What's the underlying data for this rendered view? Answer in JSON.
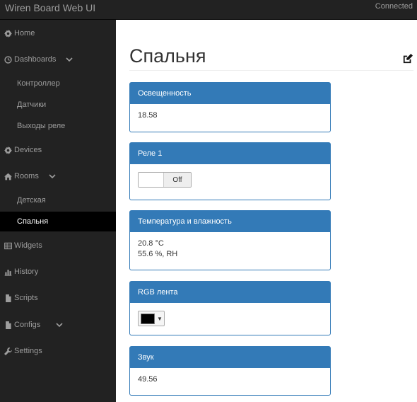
{
  "topbar": {
    "brand": "Wiren Board Web UI",
    "status": "Connected"
  },
  "sidebar": {
    "items": [
      {
        "key": "home",
        "label": "Home",
        "icon": "gear-icon"
      },
      {
        "key": "dashboards",
        "label": "Dashboards",
        "icon": "dashboard-icon"
      },
      {
        "key": "controller",
        "label": "Контроллер"
      },
      {
        "key": "sensors",
        "label": "Датчики"
      },
      {
        "key": "relay-outputs",
        "label": "Выходы реле"
      },
      {
        "key": "devices",
        "label": "Devices",
        "icon": "gear-icon"
      },
      {
        "key": "rooms",
        "label": "Rooms",
        "icon": "home-icon"
      },
      {
        "key": "kids-room",
        "label": "Детская"
      },
      {
        "key": "bedroom",
        "label": "Спальня",
        "active": true
      },
      {
        "key": "widgets",
        "label": "Widgets",
        "icon": "table-icon"
      },
      {
        "key": "history",
        "label": "History",
        "icon": "bar-chart-icon"
      },
      {
        "key": "scripts",
        "label": "Scripts",
        "icon": "file-icon"
      },
      {
        "key": "configs",
        "label": "Configs",
        "icon": "file-icon"
      },
      {
        "key": "settings",
        "label": "Settings",
        "icon": "wrench-icon"
      }
    ]
  },
  "main": {
    "title": "Спальня",
    "widgets": [
      {
        "title": "Освещенность",
        "lines": [
          "18.58"
        ]
      },
      {
        "title": "Реле 1",
        "switch_state": "Off"
      },
      {
        "title": "Температура и влажность",
        "lines": [
          "20.8 °C",
          "55.6 %, RH"
        ]
      },
      {
        "title": "RGB лента",
        "color_value": "#000000"
      },
      {
        "title": "Звук",
        "lines": [
          "49.56"
        ]
      }
    ]
  },
  "colors": {
    "navbar": "#222222",
    "active": "#000000",
    "panel_accent": "#337ab7"
  }
}
